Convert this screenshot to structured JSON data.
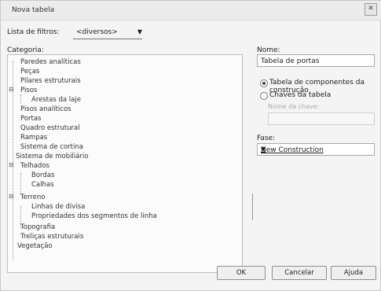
{
  "window": {
    "title": "Nova tabela",
    "close_glyph": "✕"
  },
  "filter": {
    "label": "Lista de filtros:",
    "value": "<diversos>"
  },
  "categories": {
    "label": "Categoria:",
    "items": [
      "Paredes analíticas",
      "Peças",
      "Pilares estruturais",
      "Pisos",
      "Arestas da laje",
      "Pisos analíticos",
      "Portas",
      "Quadro estrutural",
      "Rampas",
      "Sistema de cortina",
      "Sistema de mobiliário",
      "Telhados",
      "Bordas",
      "Calhas",
      "Terreno",
      "Linhas de divisa",
      "Propriedades dos segmentos de linha",
      "Topografia",
      "Treliças estruturais",
      "Vegetação"
    ]
  },
  "name": {
    "label": "Nome:",
    "value": "Tabela de portas"
  },
  "radios": {
    "schedule_building_components": "Tabela de componentes da construção",
    "schedule_keys": "Chaves da tabela"
  },
  "key_name": {
    "label": "Nome da chave:"
  },
  "phase": {
    "label": "Fase:",
    "value": "New Construction"
  },
  "buttons": {
    "ok": "OK",
    "cancel": "Cancelar",
    "help": "Ajuda"
  }
}
